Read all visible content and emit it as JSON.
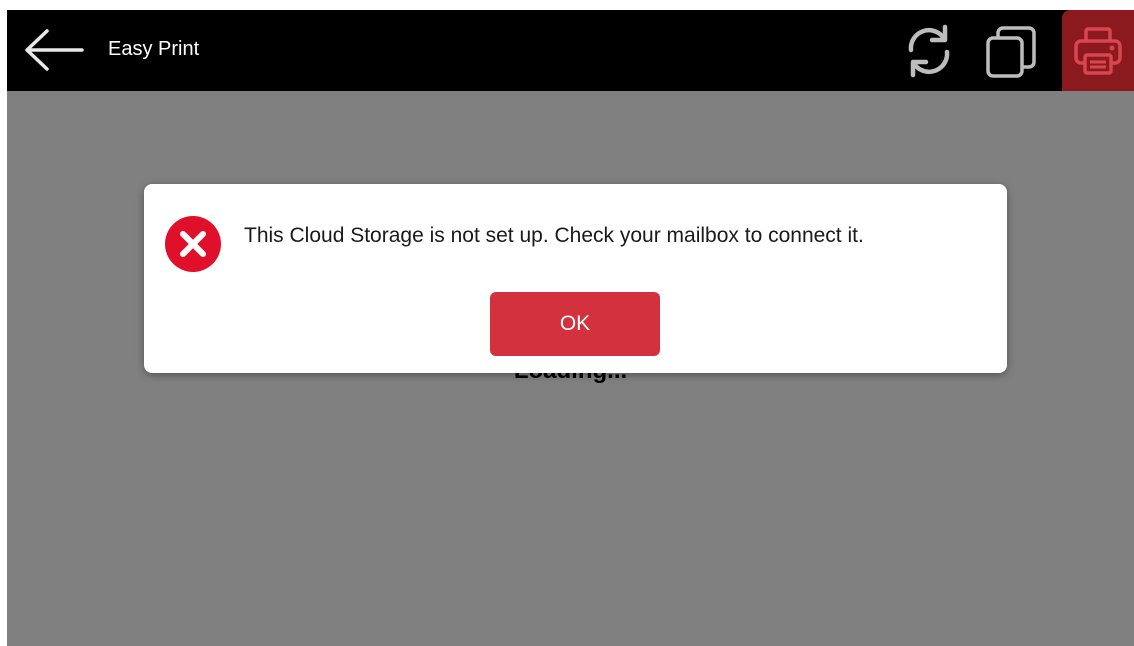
{
  "header": {
    "title": "Easy Print",
    "back_icon": "arrow-left-icon",
    "refresh_icon": "refresh-icon",
    "copies_icon": "copies-icon",
    "print_icon": "printer-icon"
  },
  "content": {
    "loading_text": "Loading..."
  },
  "dialog": {
    "icon": "error-icon",
    "message": "This Cloud Storage is not set up. Check your mailbox to connect it.",
    "ok_label": "OK"
  },
  "colors": {
    "topbar": "#000000",
    "overlay": "#808080",
    "print_button": "#8b1a1e",
    "ok_button": "#d2313d",
    "error_icon": "#e0102a"
  }
}
